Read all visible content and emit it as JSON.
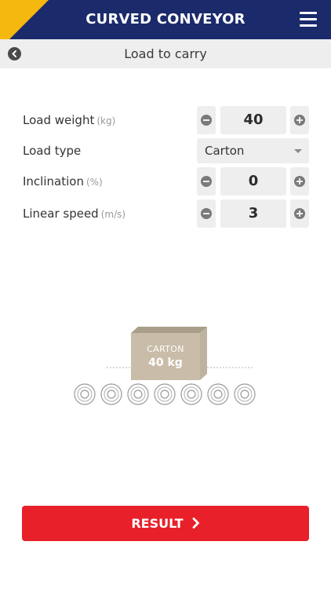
{
  "header": {
    "title": "CURVED CONVEYOR",
    "menu_icon": "hamburger-menu-icon",
    "colors": {
      "background": "#1a2a6b",
      "corner_accent": "#f5b80f"
    }
  },
  "subbar": {
    "title": "Load to carry",
    "back_icon": "back-arrow-icon"
  },
  "form": {
    "load_weight": {
      "label": "Load weight",
      "unit": "(kg)",
      "value": "40"
    },
    "load_type": {
      "label": "Load type",
      "selected": "Carton"
    },
    "inclination": {
      "label": "Inclination",
      "unit": "(%)",
      "value": "0"
    },
    "linear_speed": {
      "label": "Linear speed",
      "unit": "(m/s)",
      "value": "3"
    }
  },
  "illustration": {
    "box_label": "CARTON",
    "box_weight": "40 kg",
    "roller_count": 7
  },
  "result": {
    "label": "RESULT",
    "color": "#e8202a"
  }
}
